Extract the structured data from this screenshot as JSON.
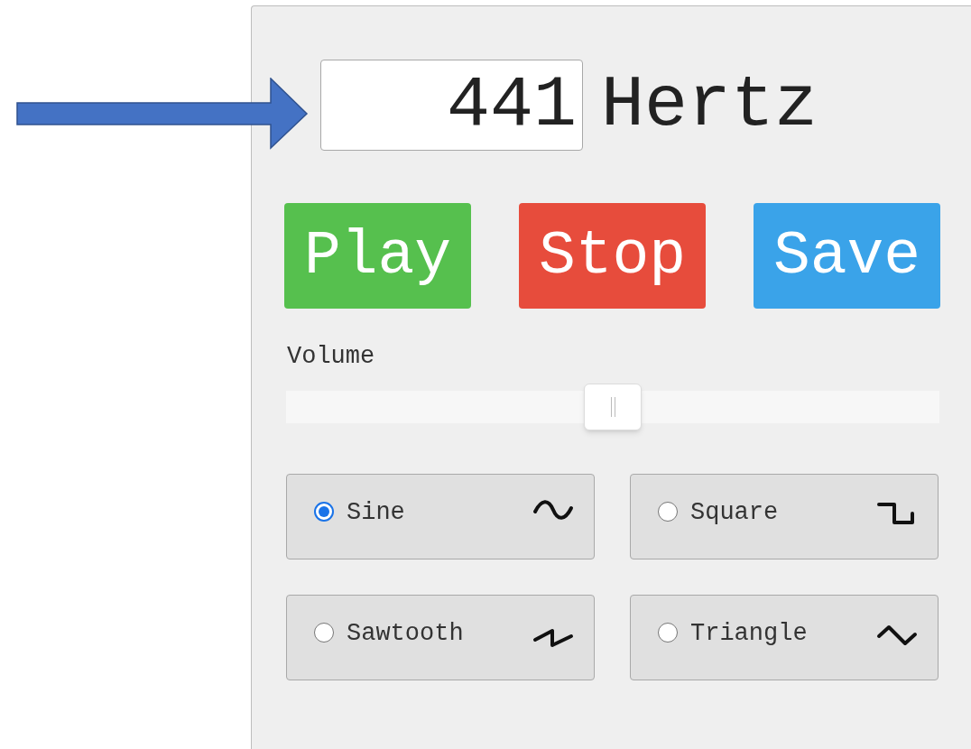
{
  "frequency": {
    "value": "441",
    "unit": "Hertz"
  },
  "buttons": [
    {
      "label": "Play",
      "kind": "play"
    },
    {
      "label": "Stop",
      "kind": "stop"
    },
    {
      "label": "Save",
      "kind": "save"
    }
  ],
  "volume": {
    "label": "Volume",
    "level": 0.5
  },
  "waveforms": [
    {
      "label": "Sine",
      "kind": "sine",
      "selected": true
    },
    {
      "label": "Square",
      "kind": "square",
      "selected": false
    },
    {
      "label": "Sawtooth",
      "kind": "sawtooth",
      "selected": false
    },
    {
      "label": "Triangle",
      "kind": "triangle",
      "selected": false
    }
  ]
}
